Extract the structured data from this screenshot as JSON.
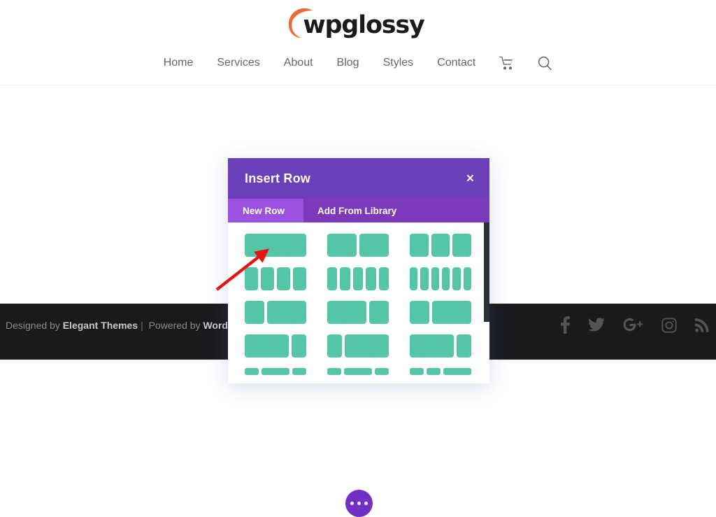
{
  "site": {
    "logo_text": "wpglossy",
    "logo_accent_color": "#ed6a3a",
    "nav": [
      {
        "label": "Home",
        "name": "nav-home"
      },
      {
        "label": "Services",
        "name": "nav-services"
      },
      {
        "label": "About",
        "name": "nav-about"
      },
      {
        "label": "Blog",
        "name": "nav-blog"
      },
      {
        "label": "Styles",
        "name": "nav-styles"
      },
      {
        "label": "Contact",
        "name": "nav-contact"
      }
    ],
    "nav_icons": [
      "cart-icon",
      "search-icon"
    ]
  },
  "footer": {
    "designed_by_prefix": "Designed by ",
    "designed_by_brand": "Elegant Themes",
    "separator": "|",
    "powered_by_prefix": " Powered by ",
    "powered_by_brand": "WordPress",
    "background_color": "#1a1a1d",
    "social": [
      "facebook-icon",
      "twitter-icon",
      "google-plus-icon",
      "instagram-icon",
      "rss-icon"
    ]
  },
  "builder": {
    "add_row_button_label": "+",
    "add_row_button_color": "#4fc4a6",
    "settings_button_label": "•••",
    "settings_button_color": "#7130c3"
  },
  "modal": {
    "title": "Insert Row",
    "close_label": "×",
    "header_color": "#6b3fb8",
    "active_tab_color": "#9b51e0",
    "inactive_tab_color": "#7c3aba",
    "column_color": "#55c5a7",
    "tabs": [
      {
        "label": "New Row",
        "active": true
      },
      {
        "label": "Add From Library",
        "active": false
      }
    ],
    "layout_rows": [
      {
        "options": [
          {
            "name": "layout-1-column",
            "widths": [
              12
            ]
          },
          {
            "name": "layout-2-columns",
            "widths": [
              6,
              6
            ]
          },
          {
            "name": "layout-3-columns",
            "widths": [
              4,
              4,
              4
            ]
          }
        ]
      },
      {
        "options": [
          {
            "name": "layout-4-columns",
            "widths": [
              3,
              3,
              3,
              3
            ]
          },
          {
            "name": "layout-5-columns",
            "widths": [
              2.4,
              2.4,
              2.4,
              2.4,
              2.4
            ]
          },
          {
            "name": "layout-6-columns",
            "widths": [
              2,
              2,
              2,
              2,
              2,
              2
            ]
          }
        ]
      },
      {
        "options": [
          {
            "name": "layout-third-twothirds",
            "widths": [
              4,
              8
            ]
          },
          {
            "name": "layout-twothirds-third",
            "widths": [
              8,
              4
            ]
          },
          {
            "name": "layout-third-twothirds-b",
            "widths": [
              4,
              8
            ]
          }
        ]
      },
      {
        "options": [
          {
            "name": "layout-threequarter-quarter",
            "widths": [
              9,
              3
            ]
          },
          {
            "name": "layout-quarter-threequarter",
            "widths": [
              3,
              9
            ]
          },
          {
            "name": "layout-threequarter-quarter-b",
            "widths": [
              9,
              3
            ]
          }
        ]
      },
      {
        "options": [
          {
            "name": "layout-partial-a",
            "widths": [
              3,
              6,
              3
            ]
          },
          {
            "name": "layout-partial-b",
            "widths": [
              3,
              6,
              3
            ]
          },
          {
            "name": "layout-partial-c",
            "widths": [
              3,
              3,
              6
            ]
          }
        ]
      }
    ]
  },
  "annotation": {
    "arrow_color": "#e81313",
    "arrow_points_to": "layout-1-column"
  }
}
